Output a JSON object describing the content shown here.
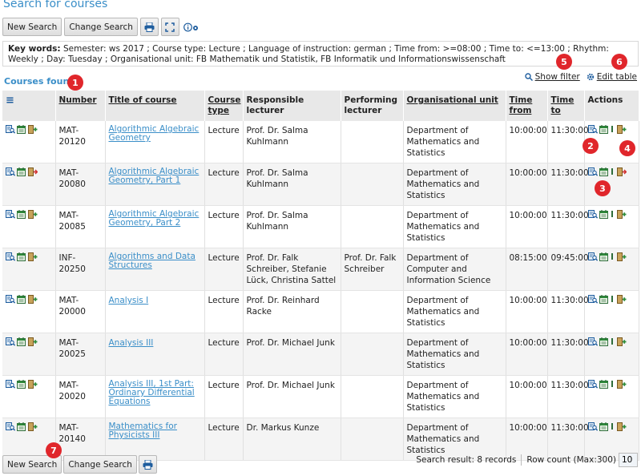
{
  "page": {
    "title": "Search for courses"
  },
  "toolbar": {
    "new_search": "New Search",
    "change_search": "Change Search",
    "print_icon": "printer-icon",
    "expand_icon": "expand-icon",
    "info_icon": "info-settings-icon"
  },
  "keywords": {
    "label": "Key words:",
    "text": "Semester: ws 2017 ;  Course type: Lecture ;  Language of instruction: german ;  Time from: >=08:00 ;  Time to: <=13:00 ;  Rhythm: Weekly ;  Day: Tuesday ;  Organisational unit: FB Mathematik und Statistik, FB Informatik und Informationswissenschaft"
  },
  "results": {
    "heading": "Courses found",
    "show_filter": "Show filter",
    "edit_table": "Edit table",
    "columns": {
      "menu": "≡",
      "number": "Number",
      "title": "Title of course",
      "course_type": "Course type",
      "responsible": "Responsible lecturer",
      "performing": "Performing lecturer",
      "org_unit": "Organisational unit",
      "time_from": "Time from",
      "time_to": "Time to",
      "actions": "Actions"
    },
    "rows": [
      {
        "number": "MAT-20120",
        "title": "Algorithmic Algebraic Geometry",
        "type": "Lecture",
        "responsible": "Prof. Dr. Salma Kuhlmann",
        "performing": "",
        "org": "Department of Mathematics and Statistics",
        "from": "10:00:00",
        "to": "11:30:00",
        "state": "add"
      },
      {
        "number": "MAT-20080",
        "title": "Algorithmic Algebraic Geometry, Part 1",
        "type": "Lecture",
        "responsible": "Prof. Dr. Salma Kuhlmann",
        "performing": "",
        "org": "Department of Mathematics and Statistics",
        "from": "10:00:00",
        "to": "11:30:00",
        "state": "remove"
      },
      {
        "number": "MAT-20085",
        "title": "Algorithmic Algebraic Geometry, Part 2",
        "type": "Lecture",
        "responsible": "Prof. Dr. Salma Kuhlmann",
        "performing": "",
        "org": "Department of Mathematics and Statistics",
        "from": "10:00:00",
        "to": "11:30:00",
        "state": "add"
      },
      {
        "number": "INF-20250",
        "title": "Algorithms and Data Structures",
        "type": "Lecture",
        "responsible": "Prof. Dr. Falk Schreiber, Stefanie Lück, Christina Sattel",
        "performing": "Prof. Dr. Falk Schreiber",
        "org": "Department of Computer and Information Science",
        "from": "08:15:00",
        "to": "09:45:00",
        "state": "add"
      },
      {
        "number": "MAT-20000",
        "title": "Analysis I",
        "type": "Lecture",
        "responsible": "Prof. Dr. Reinhard Racke",
        "performing": "",
        "org": "Department of Mathematics and Statistics",
        "from": "10:00:00",
        "to": "11:30:00",
        "state": "add"
      },
      {
        "number": "MAT-20025",
        "title": "Analysis III",
        "type": "Lecture",
        "responsible": "Prof. Dr. Michael Junk",
        "performing": "",
        "org": "Department of Mathematics and Statistics",
        "from": "10:00:00",
        "to": "11:30:00",
        "state": "add"
      },
      {
        "number": "MAT-20020",
        "title": "Analysis III, 1st Part: Ordinary Differential Equations",
        "type": "Lecture",
        "responsible": "Prof. Dr. Michael Junk",
        "performing": "",
        "org": "Department of Mathematics and Statistics",
        "from": "10:00:00",
        "to": "11:30:00",
        "state": "add"
      },
      {
        "number": "MAT-20140",
        "title": "Mathematics for Physicists III",
        "type": "Lecture",
        "responsible": "Dr. Markus Kunze",
        "performing": "",
        "org": "Department of Mathematics and Statistics",
        "from": "10:00:00",
        "to": "11:30:00",
        "state": "add"
      }
    ]
  },
  "footer": {
    "new_search": "New Search",
    "change_search": "Change Search",
    "search_result": "Search result: 8 records",
    "row_count_label": "Row count (Max:300)",
    "row_count_value": "10"
  },
  "markers": [
    "1",
    "2",
    "3",
    "4",
    "5",
    "6",
    "7"
  ],
  "colors": {
    "accent": "#3a8ec8",
    "marker": "#e0262b",
    "add": "#2e8b3a",
    "remove": "#d03030"
  }
}
